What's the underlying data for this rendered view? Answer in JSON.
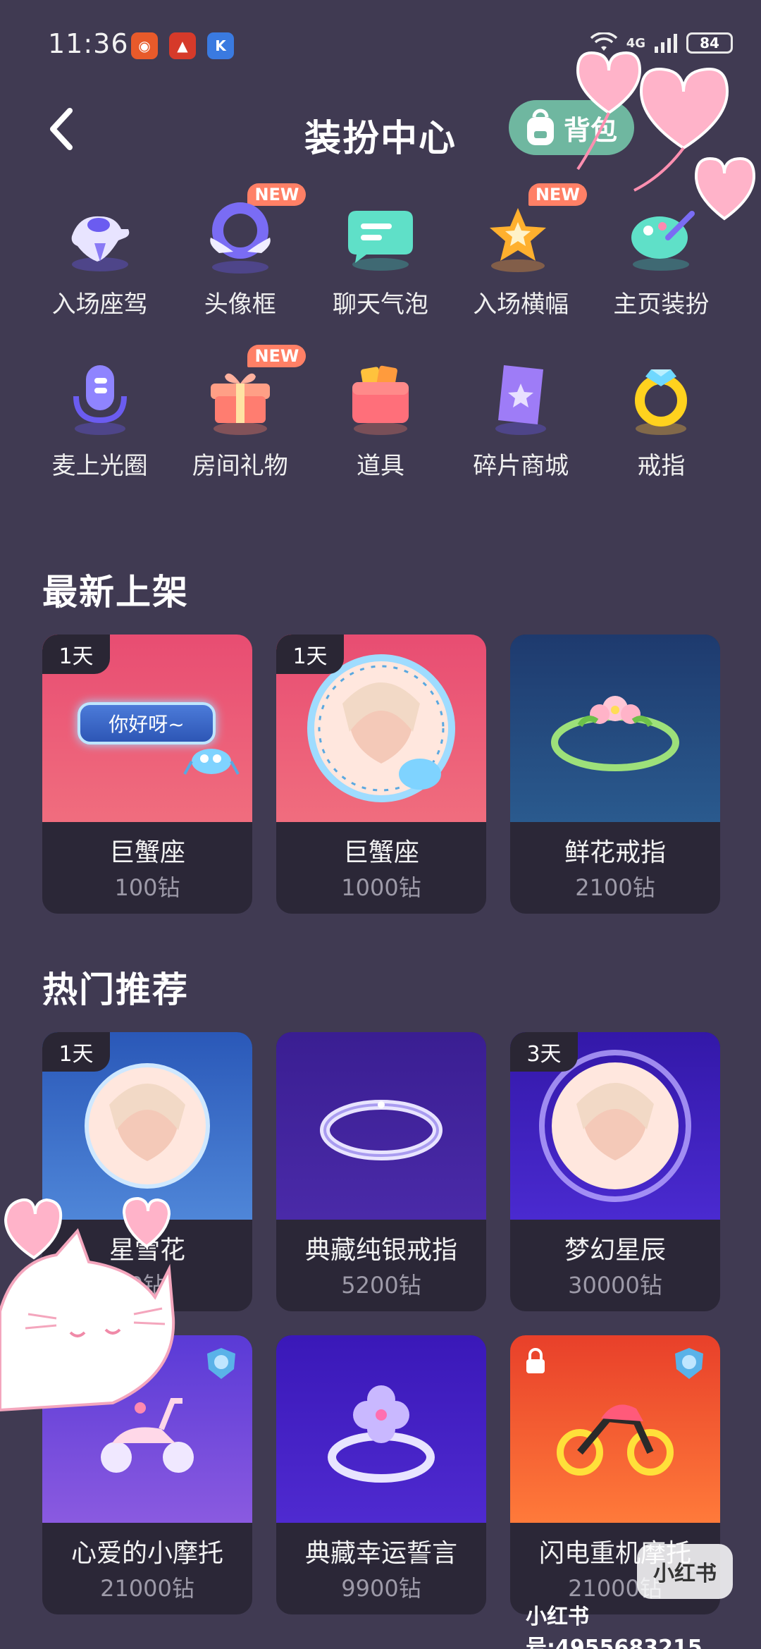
{
  "status": {
    "time": "11:36",
    "network": "4G",
    "battery": "84"
  },
  "header": {
    "title": "装扮中心",
    "bag_label": "背包"
  },
  "categories": [
    {
      "label": "入场座驾",
      "icon": "car-icon",
      "new": false
    },
    {
      "label": "头像框",
      "icon": "avatar-frame-icon",
      "new": true
    },
    {
      "label": "聊天气泡",
      "icon": "chat-bubble-icon",
      "new": false
    },
    {
      "label": "入场横幅",
      "icon": "star-banner-icon",
      "new": true
    },
    {
      "label": "主页装扮",
      "icon": "palette-icon",
      "new": false
    },
    {
      "label": "麦上光圈",
      "icon": "mic-icon",
      "new": false
    },
    {
      "label": "房间礼物",
      "icon": "gift-icon",
      "new": true
    },
    {
      "label": "道具",
      "icon": "wallet-icon",
      "new": false
    },
    {
      "label": "碎片商城",
      "icon": "ticket-icon",
      "new": false
    },
    {
      "label": "戒指",
      "icon": "ring-icon",
      "new": false
    }
  ],
  "new_badge_text": "NEW",
  "sections": {
    "newest": {
      "title": "最新上架",
      "items": [
        {
          "name": "巨蟹座",
          "price": "100钻",
          "tag": "1天",
          "art": "chat-bubble-art",
          "bubble_text": "你好呀~"
        },
        {
          "name": "巨蟹座",
          "price": "1000钻",
          "tag": "1天",
          "art": "avatar-frame-art"
        },
        {
          "name": "鲜花戒指",
          "price": "2100钻",
          "tag": "",
          "art": "flower-ring-art"
        }
      ]
    },
    "hot": {
      "title": "热门推荐",
      "items": [
        {
          "name": "星雪花",
          "price": "0钻",
          "tag": "1天",
          "art": "snow-frame-art"
        },
        {
          "name": "典藏纯银戒指",
          "price": "5200钻",
          "tag": "",
          "art": "silver-ring-art"
        },
        {
          "name": "梦幻星辰",
          "price": "30000钻",
          "tag": "3天",
          "art": "star-frame-art"
        },
        {
          "name": "心爱的小摩托",
          "price": "21000钻",
          "tag": "",
          "art": "scooter-art"
        },
        {
          "name": "典藏幸运誓言",
          "price": "9900钻",
          "tag": "",
          "art": "clover-ring-art"
        },
        {
          "name": "闪电重机摩托",
          "price": "21000钻",
          "tag": "",
          "art": "motorbike-art"
        }
      ]
    }
  },
  "watermark": {
    "logo": "小红书",
    "id_text": "小红书号:4955683215"
  },
  "colors": {
    "background": "#403a52",
    "card": "#2b2737",
    "bag_button": "#6fb7a0",
    "new_badge": "#ff8066",
    "price_text": "#9d9aa8"
  }
}
